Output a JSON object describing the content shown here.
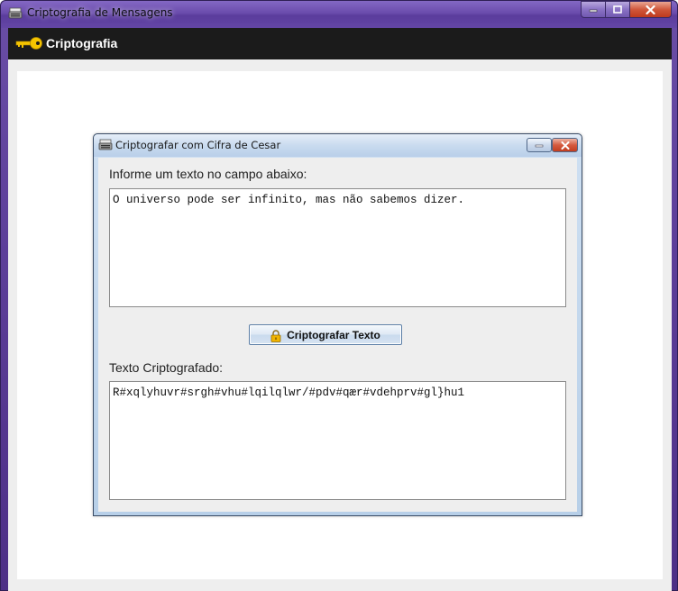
{
  "window": {
    "title": "Criptografia de Mensagens",
    "icon": "typewriter-icon",
    "controls": [
      "minimize-icon",
      "maximize-icon",
      "close-icon"
    ]
  },
  "header": {
    "icon": "key-icon",
    "title": "Criptografia",
    "icon_color": "#f5c400"
  },
  "dialog": {
    "title": "Criptografar com Cifra de Cesar",
    "icon": "typewriter-icon",
    "input_label": "Informe um texto no campo abaixo:",
    "input_value": "O universo pode ser infinito, mas não sabemos dizer.",
    "button_label": "Criptografar Texto",
    "button_icon": "lock-icon",
    "output_label": "Texto Criptografado:",
    "output_value": "R#xqlyhuvr#srgh#vhu#lqilqlwr/#pdv#qær#vdehprv#gl}hu1"
  }
}
